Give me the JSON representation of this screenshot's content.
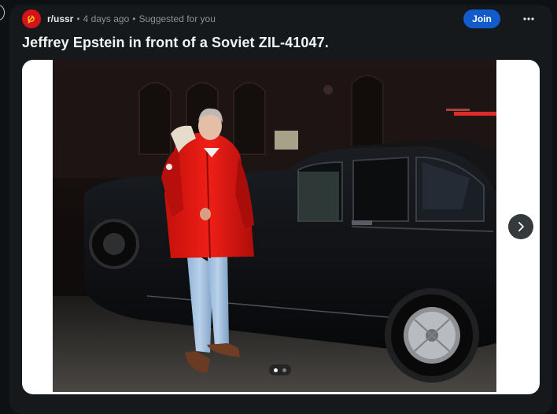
{
  "post": {
    "community": "r/ussr",
    "separator": "•",
    "time_ago": "4 days ago",
    "suggestion": "Suggested for you",
    "title": "Jeffrey Epstein in front of a Soviet ZIL-41047."
  },
  "actions": {
    "join_label": "Join",
    "more_icon": "more-horizontal-icon",
    "next_icon": "chevron-right-icon"
  },
  "gallery": {
    "current_index": 1,
    "total": 2
  },
  "colors": {
    "background": "#0e1113",
    "join_button": "#115bca",
    "community_avatar": "#d4131a",
    "meta_text": "#8a9296"
  }
}
